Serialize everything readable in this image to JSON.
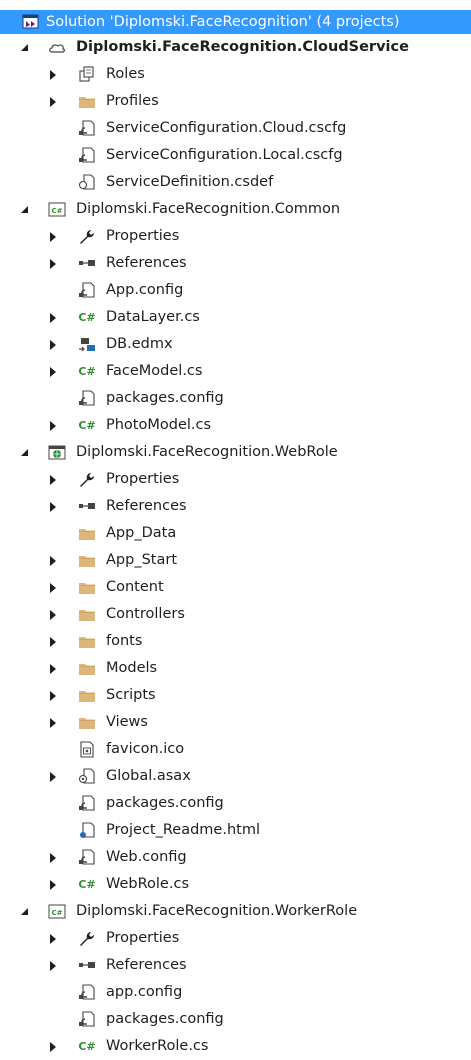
{
  "solution": {
    "label": "Solution 'Diplomski.FaceRecognition' (4 projects)",
    "icon": "solution-icon"
  },
  "projects": [
    {
      "label": "Diplomski.FaceRecognition.CloudService",
      "icon": "cloud-service-icon",
      "items": [
        {
          "label": "Roles",
          "icon": "roles-icon",
          "expander": "collapsed"
        },
        {
          "label": "Profiles",
          "icon": "folder-icon",
          "expander": "collapsed"
        },
        {
          "label": "ServiceConfiguration.Cloud.cscfg",
          "icon": "config-file-icon",
          "expander": "none"
        },
        {
          "label": "ServiceConfiguration.Local.cscfg",
          "icon": "config-file-icon",
          "expander": "none"
        },
        {
          "label": "ServiceDefinition.csdef",
          "icon": "service-definition-icon",
          "expander": "none"
        }
      ]
    },
    {
      "label": "Diplomski.FaceRecognition.Common",
      "icon": "csharp-project-icon",
      "items": [
        {
          "label": "Properties",
          "icon": "wrench-icon",
          "expander": "collapsed"
        },
        {
          "label": "References",
          "icon": "references-icon",
          "expander": "collapsed"
        },
        {
          "label": "App.config",
          "icon": "config-file-icon",
          "expander": "none"
        },
        {
          "label": "DataLayer.cs",
          "icon": "csharp-file-icon",
          "expander": "collapsed"
        },
        {
          "label": "DB.edmx",
          "icon": "edmx-icon",
          "expander": "collapsed"
        },
        {
          "label": "FaceModel.cs",
          "icon": "csharp-file-icon",
          "expander": "collapsed"
        },
        {
          "label": "packages.config",
          "icon": "config-file-icon",
          "expander": "none"
        },
        {
          "label": "PhotoModel.cs",
          "icon": "csharp-file-icon",
          "expander": "collapsed"
        }
      ]
    },
    {
      "label": "Diplomski.FaceRecognition.WebRole",
      "icon": "web-project-icon",
      "items": [
        {
          "label": "Properties",
          "icon": "wrench-icon",
          "expander": "collapsed"
        },
        {
          "label": "References",
          "icon": "references-icon",
          "expander": "collapsed"
        },
        {
          "label": "App_Data",
          "icon": "folder-icon",
          "expander": "none"
        },
        {
          "label": "App_Start",
          "icon": "folder-icon",
          "expander": "collapsed"
        },
        {
          "label": "Content",
          "icon": "folder-icon",
          "expander": "collapsed"
        },
        {
          "label": "Controllers",
          "icon": "folder-icon",
          "expander": "collapsed"
        },
        {
          "label": "fonts",
          "icon": "folder-icon",
          "expander": "collapsed"
        },
        {
          "label": "Models",
          "icon": "folder-icon",
          "expander": "collapsed"
        },
        {
          "label": "Scripts",
          "icon": "folder-icon",
          "expander": "collapsed"
        },
        {
          "label": "Views",
          "icon": "folder-icon",
          "expander": "collapsed"
        },
        {
          "label": "favicon.ico",
          "icon": "icon-file-icon",
          "expander": "none"
        },
        {
          "label": "Global.asax",
          "icon": "asax-file-icon",
          "expander": "collapsed"
        },
        {
          "label": "packages.config",
          "icon": "config-file-icon",
          "expander": "none"
        },
        {
          "label": "Project_Readme.html",
          "icon": "html-file-icon",
          "expander": "none"
        },
        {
          "label": "Web.config",
          "icon": "config-file-icon",
          "expander": "collapsed"
        },
        {
          "label": "WebRole.cs",
          "icon": "csharp-file-icon",
          "expander": "collapsed"
        }
      ]
    },
    {
      "label": "Diplomski.FaceRecognition.WorkerRole",
      "icon": "csharp-project-icon",
      "items": [
        {
          "label": "Properties",
          "icon": "wrench-icon",
          "expander": "collapsed"
        },
        {
          "label": "References",
          "icon": "references-icon",
          "expander": "collapsed"
        },
        {
          "label": "app.config",
          "icon": "config-file-icon",
          "expander": "none"
        },
        {
          "label": "packages.config",
          "icon": "config-file-icon",
          "expander": "none"
        },
        {
          "label": "WorkerRole.cs",
          "icon": "csharp-file-icon",
          "expander": "collapsed"
        }
      ]
    }
  ],
  "colors": {
    "selection": "#3399ff",
    "folder": "#dcb67a",
    "csharp": "#388a34",
    "text": "#1e1e1e"
  }
}
